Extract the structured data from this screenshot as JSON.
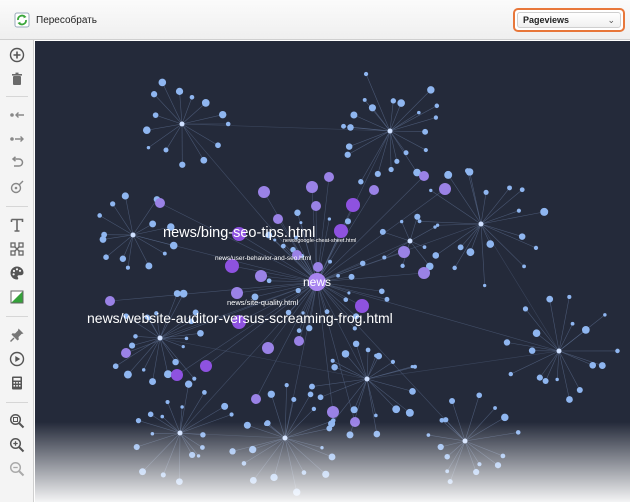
{
  "toolbar": {
    "rebuild_label": "Пересобрать",
    "metric_selected": "Pageviews"
  },
  "sidebar_tools": [
    {
      "name": "add-node-icon"
    },
    {
      "name": "delete-icon"
    },
    {
      "name": "collapse-incoming-icon"
    },
    {
      "name": "expand-outgoing-icon"
    },
    {
      "name": "undo-icon"
    },
    {
      "name": "locate-icon"
    },
    {
      "name": "text-icon"
    },
    {
      "name": "layout-nodes-icon"
    },
    {
      "name": "palette-icon"
    },
    {
      "name": "color-fill-icon"
    },
    {
      "name": "pin-icon"
    },
    {
      "name": "play-icon"
    },
    {
      "name": "calculator-icon"
    },
    {
      "name": "zoom-fit-icon"
    },
    {
      "name": "zoom-in-icon"
    },
    {
      "name": "zoom-out-icon"
    }
  ],
  "graph": {
    "labels": {
      "center": "news",
      "bing": "news/bing-seo-tips.html",
      "google": "news/google-cheat-sheet.html",
      "user": "news/user-behavior-and-seo.html",
      "quality": "news/site-quality.html",
      "auditor": "news/website-auditor-versus-screaming-frog.html"
    },
    "colors": {
      "edge": "#5a6b8c",
      "leaf": "#8fb6f0",
      "hub": "#9a82e6",
      "highlight": "#8e52e0",
      "background": "#242a3a"
    }
  }
}
